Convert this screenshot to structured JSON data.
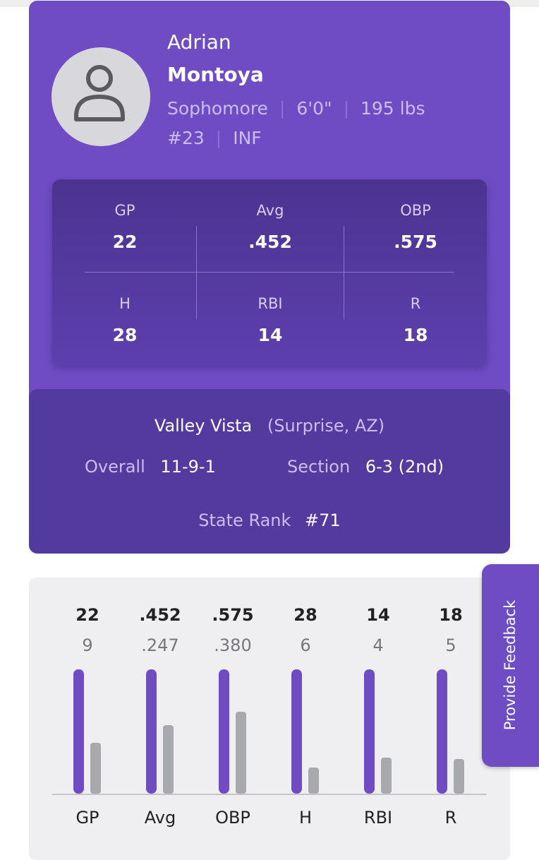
{
  "player": {
    "first_name": "Adrian",
    "last_name": "Montoya",
    "class_year": "Sophomore",
    "height": "6'0\"",
    "weight": "195 lbs",
    "number": "#23",
    "position": "INF",
    "separator": "|"
  },
  "stats": [
    {
      "label": "GP",
      "value": "22"
    },
    {
      "label": "Avg",
      "value": ".452"
    },
    {
      "label": "OBP",
      "value": ".575"
    },
    {
      "label": "H",
      "value": "28"
    },
    {
      "label": "RBI",
      "value": "14"
    },
    {
      "label": "R",
      "value": "18"
    }
  ],
  "team": {
    "name": "Valley Vista",
    "location": "(Surprise, AZ)",
    "overall_label": "Overall",
    "overall_value": "11-9-1",
    "section_label": "Section",
    "section_value": "6-3 (2nd)",
    "rank_label": "State Rank",
    "rank_value": "#71"
  },
  "chart_data": {
    "type": "bar",
    "categories": [
      "GP",
      "Avg",
      "OBP",
      "H",
      "RBI",
      "R"
    ],
    "series": [
      {
        "values": [
          22,
          0.452,
          0.575,
          28,
          14,
          18
        ],
        "labels": [
          "22",
          ".452",
          ".575",
          "28",
          "14",
          "18"
        ],
        "color": "#6f4cc4"
      },
      {
        "values": [
          9,
          0.247,
          0.38,
          6,
          4,
          5
        ],
        "labels": [
          "9",
          ".247",
          ".380",
          "6",
          "4",
          "5"
        ],
        "color": "#a7a9ad"
      }
    ],
    "relative_heights": [
      0.41,
      0.55,
      0.66,
      0.21,
      0.29,
      0.28
    ]
  },
  "feedback": {
    "label": "Provide Feedback"
  },
  "colors": {
    "accent": "#6f4cc4",
    "comparison": "#a7a9ad"
  }
}
